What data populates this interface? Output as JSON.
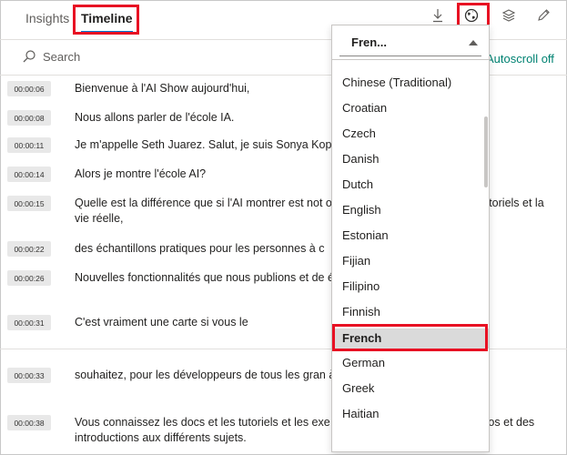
{
  "tabs": [
    {
      "label": "Insights",
      "active": false
    },
    {
      "label": "Timeline",
      "active": true
    }
  ],
  "toolbar": {
    "icons": [
      "download-icon",
      "globe-icon",
      "layers-icon",
      "edit-icon"
    ]
  },
  "search": {
    "placeholder": "Search",
    "autoscroll_label": "Autoscroll off"
  },
  "transcript": [
    {
      "time": "00:00:06",
      "text": "Bienvenue à l'AI Show aujourd'hui,"
    },
    {
      "time": "00:00:08",
      "text": "Nous allons parler de l'école IA."
    },
    {
      "time": "00:00:11",
      "text": "Je m'appelle Seth Juarez. Salut, je suis Sonya Kopt"
    },
    {
      "time": "00:00:14",
      "text": "Alors je montre l'école AI?"
    },
    {
      "time": "00:00:15",
      "text": "Quelle est la différence que si l'AI montrer est not                              ode des fonctionnalités et des tutoriels et la vie réelle,"
    },
    {
      "time": "00:00:22",
      "text": "des échantillons pratiques pour les personnes à c"
    },
    {
      "time": "00:00:26",
      "text": "Nouvelles fonctionnalités que nous publions et de                              école secondaire."
    },
    {
      "time": "00:00:31",
      "text": "C'est vraiment une carte si vous le"
    },
    {
      "time": "00:00:33",
      "text": "souhaitez, pour les développeurs de tous les gran                              à-bas."
    },
    {
      "time": "00:00:38",
      "text": "Vous connaissez les docs et les tutoriels et les exe                              également en vedette des vidéos et des introductions aux différents sujets."
    }
  ],
  "language_dropdown": {
    "selected_display": "Fren...",
    "options": [
      "Chinese (Traditional)",
      "Croatian",
      "Czech",
      "Danish",
      "Dutch",
      "English",
      "Estonian",
      "Fijian",
      "Filipino",
      "Finnish",
      "French",
      "German",
      "Greek",
      "Haitian"
    ],
    "selected_option": "French"
  },
  "colors": {
    "highlight": "#e81123",
    "accent": "#0078d4",
    "autoscroll": "#008272"
  }
}
